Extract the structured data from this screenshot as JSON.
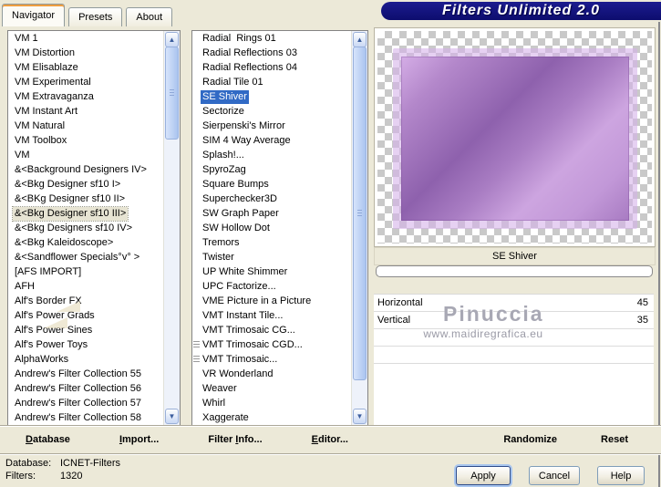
{
  "title": "Filters Unlimited 2.0",
  "tabs": [
    {
      "label": "Navigator",
      "active": true
    },
    {
      "label": "Presets",
      "active": false
    },
    {
      "label": "About",
      "active": false
    }
  ],
  "category_list": {
    "items": [
      {
        "label": "VM 1"
      },
      {
        "label": "VM Distortion"
      },
      {
        "label": "VM Elisablaze"
      },
      {
        "label": "VM Experimental"
      },
      {
        "label": "VM Extravaganza"
      },
      {
        "label": "VM Instant Art"
      },
      {
        "label": "VM Natural"
      },
      {
        "label": "VM Toolbox"
      },
      {
        "label": "VM"
      },
      {
        "label": "&<Background Designers IV>"
      },
      {
        "label": "&<Bkg Designer sf10 I>"
      },
      {
        "label": "&<BKg Designer sf10 II>"
      },
      {
        "label": "&<Bkg Designer sf10 III>",
        "selected": true
      },
      {
        "label": "&<Bkg Designers sf10 IV>"
      },
      {
        "label": "&<Bkg Kaleidoscope>"
      },
      {
        "label": "&<Sandflower Specials°v° >"
      },
      {
        "label": "[AFS IMPORT]"
      },
      {
        "label": "AFH"
      },
      {
        "label": "Alf's Border FX"
      },
      {
        "label": "Alf's Power Grads"
      },
      {
        "label": "Alf's Power Sines"
      },
      {
        "label": "Alf's Power Toys"
      },
      {
        "label": "AlphaWorks"
      },
      {
        "label": "Andrew's Filter Collection 55"
      },
      {
        "label": "Andrew's Filter Collection 56"
      },
      {
        "label": "Andrew's Filter Collection 57"
      },
      {
        "label": "Andrew's Filter Collection 58"
      }
    ]
  },
  "filter_list": {
    "items": [
      {
        "label": "Radial  Rings 01"
      },
      {
        "label": "Radial Reflections 03"
      },
      {
        "label": "Radial Reflections 04"
      },
      {
        "label": "Radial Tile 01"
      },
      {
        "label": "SE Shiver",
        "selected": true
      },
      {
        "label": "Sectorize"
      },
      {
        "label": "Sierpenski's Mirror"
      },
      {
        "label": "SIM 4 Way Average"
      },
      {
        "label": "Splash!..."
      },
      {
        "label": "SpyroZag"
      },
      {
        "label": "Square Bumps"
      },
      {
        "label": "Superchecker3D"
      },
      {
        "label": "SW Graph Paper"
      },
      {
        "label": "SW Hollow Dot"
      },
      {
        "label": "Tremors"
      },
      {
        "label": "Twister"
      },
      {
        "label": "UP White Shimmer"
      },
      {
        "label": "UPC Factorize..."
      },
      {
        "label": "VME Picture in a Picture"
      },
      {
        "label": "VMT Instant Tile..."
      },
      {
        "label": "VMT Trimosaic CG..."
      },
      {
        "label": "VMT Trimosaic CGD...",
        "icon": "list-lines-icon"
      },
      {
        "label": "VMT Trimosaic...",
        "icon": "list-lines-icon"
      },
      {
        "label": "VR Wonderland"
      },
      {
        "label": "Weaver"
      },
      {
        "label": "Whirl"
      },
      {
        "label": "Xaggerate"
      }
    ]
  },
  "preview": {
    "caption": "SE Shiver"
  },
  "params": [
    {
      "label": "Horizontal",
      "value": "45"
    },
    {
      "label": "Vertical",
      "value": "35"
    },
    {
      "label": "",
      "value": ""
    },
    {
      "label": "",
      "value": ""
    }
  ],
  "watermark": {
    "name": "Pinuccia",
    "url": "www.maidiregrafica.eu"
  },
  "command_bar": {
    "database": {
      "pre": "",
      "accel": "D",
      "post": "atabase"
    },
    "import": {
      "pre": "",
      "accel": "I",
      "post": "mport..."
    },
    "filter_info": {
      "pre": "Filter ",
      "accel": "I",
      "post": "nfo..."
    },
    "editor": {
      "pre": "",
      "accel": "E",
      "post": "ditor..."
    },
    "randomize": "Randomize",
    "reset": "Reset"
  },
  "status": {
    "database_label": "Database:",
    "database_value": "ICNET-Filters",
    "filters_label": "Filters:",
    "filters_value": "1320"
  },
  "action_buttons": {
    "apply": "Apply",
    "cancel": "Cancel",
    "help": "Help"
  },
  "icons": {
    "scroll_up": "▲",
    "scroll_down": "▼"
  },
  "colors": {
    "selection_blue": "#316ac5",
    "title_navy": "#10107e",
    "dialog_beige": "#ece9d8",
    "tab_accent_orange": "#ef9e40",
    "preview_purple_light": "#d4ade6",
    "preview_purple_dark": "#8e61ad"
  }
}
